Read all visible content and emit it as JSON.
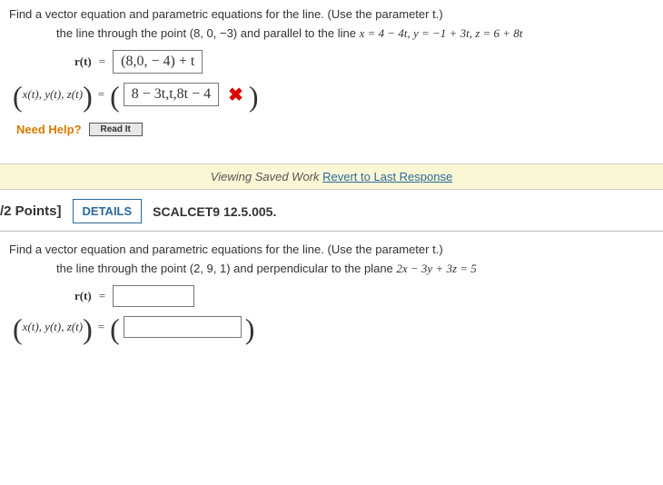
{
  "q1": {
    "prompt": "Find a vector equation and parametric equations for the line. (Use the parameter t.)",
    "subtext_prefix": "the line through the point ",
    "point": "(8, 0, −3)",
    "subtext_mid": " and parallel to the line ",
    "parallel_eqs": "x = 4 − 4t, y = −1 + 3t, z = 6 + 8t",
    "r_lhs": "r(t)",
    "eq": " = ",
    "r_answer": "(8,0, − 4) + t",
    "xyz_lhs": "x(t), y(t), z(t)",
    "xyz_answer": "8 − 3t,t,8t − 4",
    "need_help": "Need Help?",
    "read_it": "Read It",
    "x_mark": "✖"
  },
  "saved_bar": {
    "viewing": "Viewing Saved Work ",
    "revert": "Revert to Last Response"
  },
  "q2": {
    "points": "/2 Points]",
    "details": "DETAILS",
    "exercise": "SCALCET9 12.5.005.",
    "prompt": "Find a vector equation and parametric equations for the line. (Use the parameter t.)",
    "subtext_prefix": "the line through the point ",
    "point": "(2, 9, 1)",
    "subtext_mid": " and perpendicular to the plane ",
    "plane_eq": "2x − 3y + 3z = 5",
    "r_lhs": "r(t)",
    "eq": " = ",
    "xyz_lhs": "x(t), y(t), z(t)"
  }
}
